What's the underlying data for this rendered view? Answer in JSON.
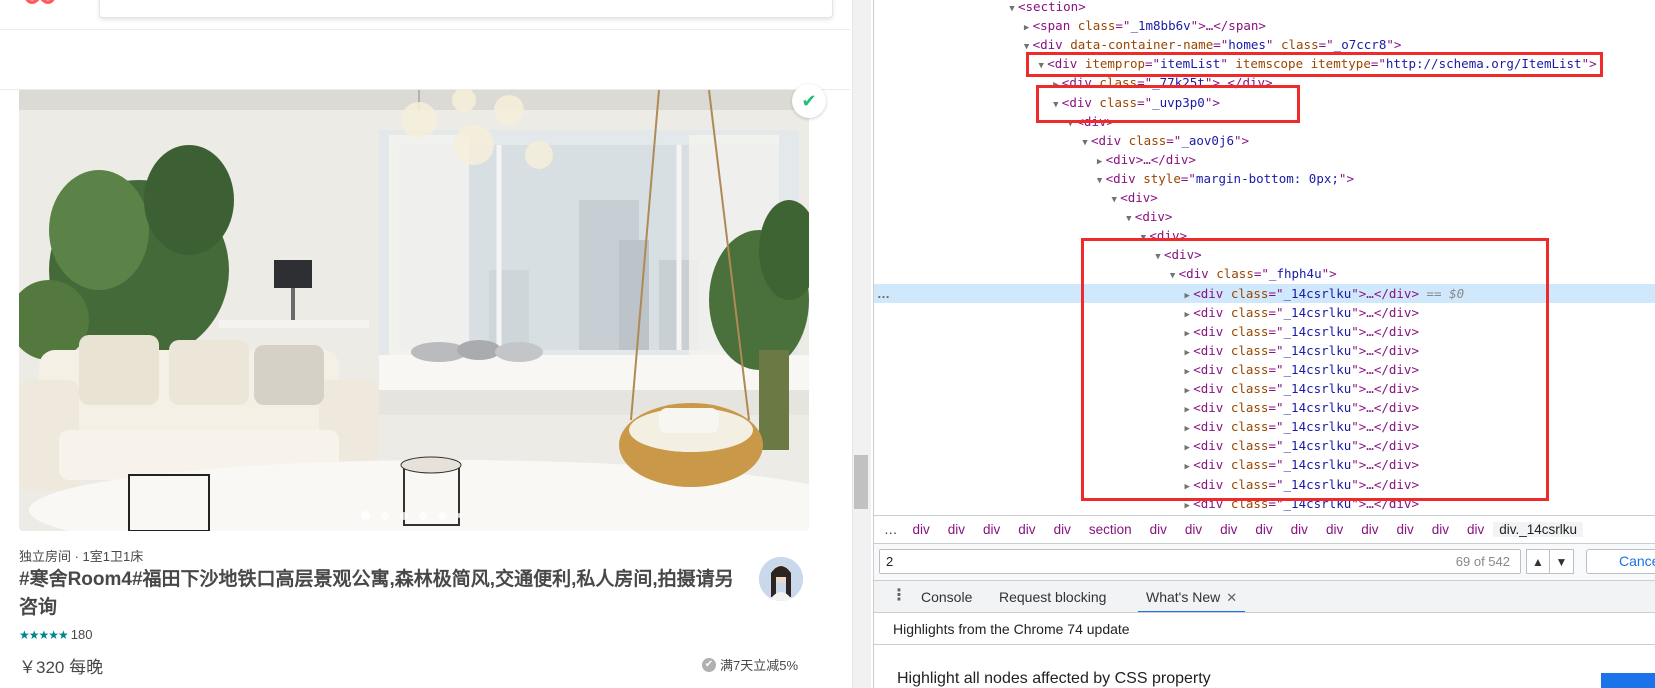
{
  "listing": {
    "room_type": "独立房间 · 1室1卫1床",
    "title": "#寒舍Room4#福田下沙地铁口高层景观公寓,森林极简风,交通便利,私人房间,拍摄请另咨询",
    "stars": "★★★★★",
    "rating_count": "180",
    "price": "￥320 每晚",
    "discount": "满7天立减5%",
    "photo_dots": 6,
    "photo_dot_active": 0
  },
  "devtools": {
    "dom_lines": [
      {
        "indent": 0,
        "tri": "▼",
        "tag": "section",
        "attrs": [],
        "close": ""
      },
      {
        "indent": 1,
        "tri": "▶",
        "tag": "span",
        "attrs": [
          [
            "class",
            "_1m8bb6v"
          ]
        ],
        "close": "…</span>"
      },
      {
        "indent": 1,
        "tri": "▼",
        "tag": "div",
        "attrs": [
          [
            "data-container-name",
            "homes"
          ],
          [
            "class",
            "_o7ccr8"
          ]
        ],
        "close": ""
      },
      {
        "indent": 2,
        "tri": "▼",
        "tag": "div",
        "attrs": [
          [
            "itemprop",
            "itemList"
          ],
          [
            "itemscope",
            null
          ],
          [
            "itemtype",
            "http://schema.org/ItemList"
          ]
        ],
        "close": ""
      },
      {
        "indent": 3,
        "tri": "▶",
        "tag": "div",
        "attrs": [
          [
            "class",
            "_77k25t"
          ]
        ],
        "close": "…</div>"
      },
      {
        "indent": 3,
        "tri": "▼",
        "tag": "div",
        "attrs": [
          [
            "class",
            "_uvp3p0"
          ]
        ],
        "close": ""
      },
      {
        "indent": 4,
        "tri": "▼",
        "tag": "div",
        "attrs": [],
        "close": ""
      },
      {
        "indent": 5,
        "tri": "▼",
        "tag": "div",
        "attrs": [
          [
            "class",
            "_aov0j6"
          ]
        ],
        "close": ""
      },
      {
        "indent": 6,
        "tri": "▶",
        "tag": "div",
        "attrs": [],
        "close": "…</div>"
      },
      {
        "indent": 6,
        "tri": "▼",
        "tag": "div",
        "attrs": [
          [
            "style",
            "margin-bottom: 0px;"
          ]
        ],
        "close": ""
      },
      {
        "indent": 7,
        "tri": "▼",
        "tag": "div",
        "attrs": [],
        "close": ""
      },
      {
        "indent": 8,
        "tri": "▼",
        "tag": "div",
        "attrs": [],
        "close": ""
      },
      {
        "indent": 9,
        "tri": "▼",
        "tag": "div",
        "attrs": [],
        "close": ""
      },
      {
        "indent": 10,
        "tri": "▼",
        "tag": "div",
        "attrs": [],
        "close": ""
      },
      {
        "indent": 11,
        "tri": "▼",
        "tag": "div",
        "attrs": [
          [
            "class",
            "_fhph4u"
          ]
        ],
        "close": ""
      },
      {
        "indent": 12,
        "tri": "▶",
        "tag": "div",
        "attrs": [
          [
            "class",
            "_14csrlku"
          ]
        ],
        "close": "…</div>",
        "suffix": " == $0",
        "selected": true
      },
      {
        "indent": 12,
        "tri": "▶",
        "tag": "div",
        "attrs": [
          [
            "class",
            "_14csrlku"
          ]
        ],
        "close": "…</div>"
      },
      {
        "indent": 12,
        "tri": "▶",
        "tag": "div",
        "attrs": [
          [
            "class",
            "_14csrlku"
          ]
        ],
        "close": "…</div>"
      },
      {
        "indent": 12,
        "tri": "▶",
        "tag": "div",
        "attrs": [
          [
            "class",
            "_14csrlku"
          ]
        ],
        "close": "…</div>"
      },
      {
        "indent": 12,
        "tri": "▶",
        "tag": "div",
        "attrs": [
          [
            "class",
            "_14csrlku"
          ]
        ],
        "close": "…</div>"
      },
      {
        "indent": 12,
        "tri": "▶",
        "tag": "div",
        "attrs": [
          [
            "class",
            "_14csrlku"
          ]
        ],
        "close": "…</div>"
      },
      {
        "indent": 12,
        "tri": "▶",
        "tag": "div",
        "attrs": [
          [
            "class",
            "_14csrlku"
          ]
        ],
        "close": "…</div>"
      },
      {
        "indent": 12,
        "tri": "▶",
        "tag": "div",
        "attrs": [
          [
            "class",
            "_14csrlku"
          ]
        ],
        "close": "…</div>"
      },
      {
        "indent": 12,
        "tri": "▶",
        "tag": "div",
        "attrs": [
          [
            "class",
            "_14csrlku"
          ]
        ],
        "close": "…</div>"
      },
      {
        "indent": 12,
        "tri": "▶",
        "tag": "div",
        "attrs": [
          [
            "class",
            "_14csrlku"
          ]
        ],
        "close": "…</div>"
      },
      {
        "indent": 12,
        "tri": "▶",
        "tag": "div",
        "attrs": [
          [
            "class",
            "_14csrlku"
          ]
        ],
        "close": "…</div>"
      },
      {
        "indent": 12,
        "tri": "▶",
        "tag": "div",
        "attrs": [
          [
            "class",
            "_14csrlku"
          ]
        ],
        "close": "…</div>"
      }
    ],
    "selected_marker": "…",
    "breadcrumbs": [
      "div",
      "div",
      "div",
      "div",
      "div",
      "section",
      "div",
      "div",
      "div",
      "div",
      "div",
      "div",
      "div",
      "div",
      "div",
      "div"
    ],
    "breadcrumb_more": "…",
    "breadcrumb_current": "div._14csrlku",
    "search_value": "2",
    "match_count": "69 of 542",
    "cancel_label": "Cancel",
    "drawer_tabs": {
      "menu": "⋮",
      "console": "Console",
      "request_blocking": "Request blocking",
      "whats_new": "What's New",
      "close": "✕"
    },
    "whats_new_header": "Highlights from the Chrome 74 update",
    "whats_new_feature": "Highlight all nodes affected by CSS property"
  },
  "colors": {
    "highlight_box": "#ee2a2a",
    "selected_row": "#cfe8fc",
    "tag": "#881280",
    "attr_name": "#994500",
    "attr_value": "#1a1aa6",
    "rating_star": "#008489",
    "verified": "#20c07a"
  },
  "icons": [
    "airbnb-logo-icon",
    "verified-check-icon",
    "discount-check-icon",
    "expand-triangle-icon",
    "collapse-triangle-icon",
    "drawer-menu-icon",
    "arrow-up-icon",
    "arrow-down-icon",
    "close-icon"
  ]
}
